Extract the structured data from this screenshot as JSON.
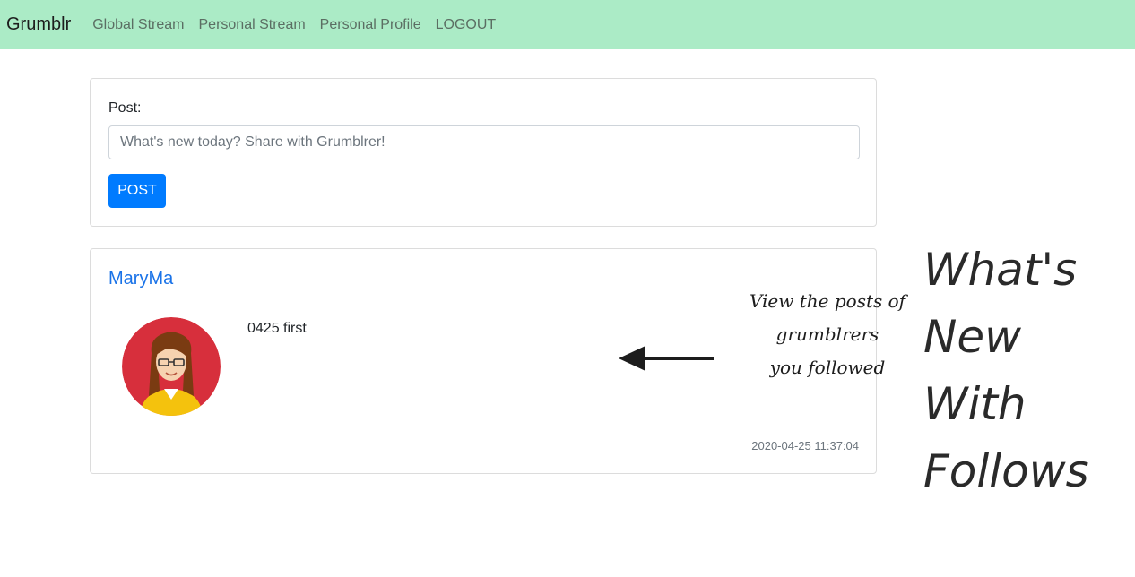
{
  "nav": {
    "brand": "Grumblr",
    "links": [
      "Global Stream",
      "Personal Stream",
      "Personal Profile",
      "LOGOUT"
    ]
  },
  "post_form": {
    "label": "Post:",
    "placeholder": "What's new today? Share with Grumblrer!",
    "button_label": "POST"
  },
  "stream": {
    "posts": [
      {
        "username": "MaryMa",
        "content": "0425 first",
        "timestamp": "2020-04-25 11:37:04",
        "avatar_icon": "user-avatar-woman"
      }
    ]
  },
  "annotation": {
    "lines": [
      "View the posts of",
      "grumblrers",
      "you followed"
    ],
    "arrow_icon": "left-arrow"
  },
  "title_words": [
    "What's",
    "New",
    "With",
    "Follows"
  ],
  "colors": {
    "navbar_bg": "#abebc6",
    "accent": "#007bff",
    "username": "#1a73e8",
    "avatar_bg": "#d72f3c"
  }
}
